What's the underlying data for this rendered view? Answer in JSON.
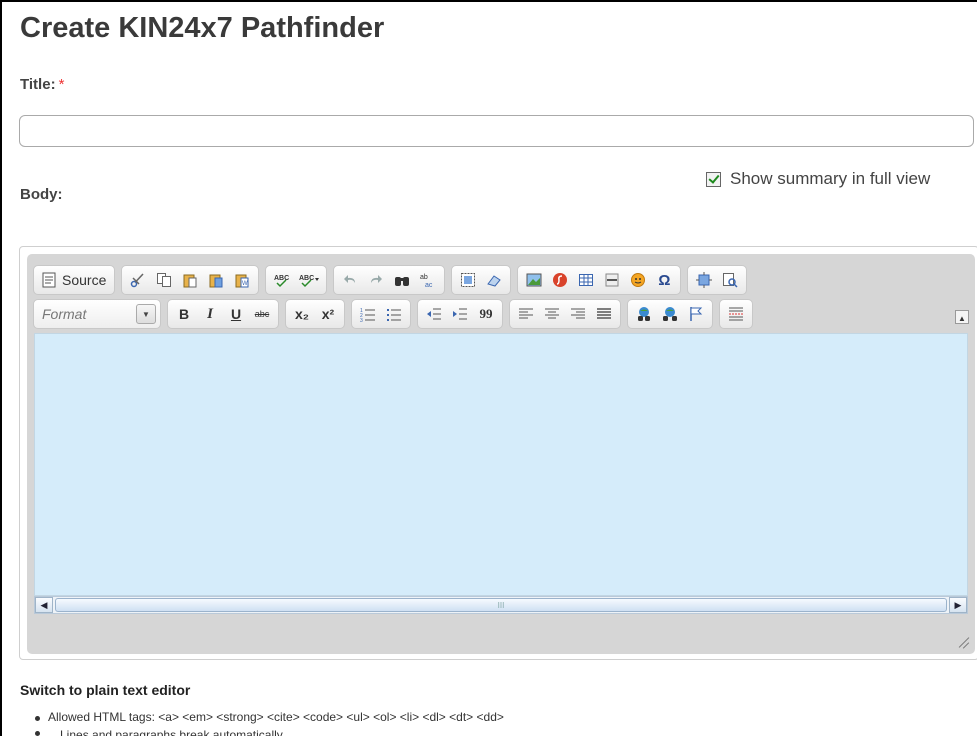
{
  "page": {
    "title": "Create KIN24x7 Pathfinder"
  },
  "form": {
    "title_label": "Title:",
    "required_mark": "*",
    "title_value": "",
    "summary_label": "Show summary in full view",
    "summary_checked": true,
    "body_label": "Body:"
  },
  "editor": {
    "source_label": "Source",
    "format_label": "Format",
    "toolbar_row1": [
      [
        "cut-icon",
        "copy-icon",
        "paste-icon",
        "paste-text-icon",
        "paste-word-icon"
      ],
      [
        "spellcheck-icon",
        "spellcheck-menu-icon"
      ],
      [
        "undo-icon",
        "redo-icon",
        "find-icon",
        "replace-icon"
      ],
      [
        "select-all-icon",
        "remove-format-icon"
      ],
      [
        "image-icon",
        "flash-icon",
        "table-icon",
        "horizontal-rule-icon",
        "smiley-icon",
        "special-char-icon"
      ],
      [
        "maximize-icon",
        "show-blocks-icon"
      ]
    ],
    "bold": "B",
    "italic": "I",
    "underline": "U",
    "strike": "abc",
    "subscript": "x₂",
    "superscript": "x²",
    "blockquote": "99",
    "special_char": "Ω",
    "scroll_thumb_marker": "III"
  },
  "footer": {
    "switch_label": "Switch to plain text editor",
    "allowed_tags": "Allowed HTML tags: <a> <em> <strong> <cite> <code> <ul> <ol> <li> <dl> <dt> <dd>",
    "line_breaks": "Lines and paragraphs break automatically."
  },
  "colors": {
    "content_bg": "#d5ecfa",
    "toolbar_bg": "#d6d6d6",
    "required": "#e33"
  }
}
